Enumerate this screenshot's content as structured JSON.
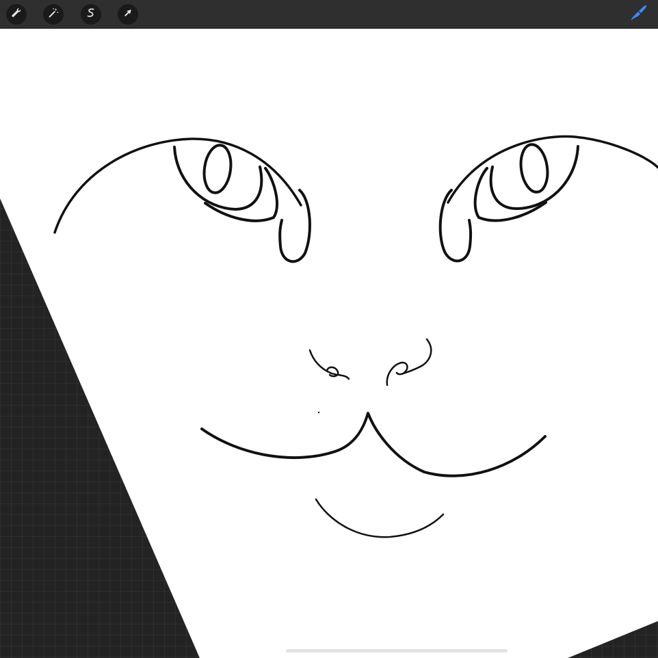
{
  "app": {
    "background_color": "#232323",
    "canvas_color": "#ffffff",
    "stroke_color": "#111111",
    "accent_color": "#3a8bff"
  },
  "toolbar": {
    "tools": [
      {
        "name": "actions",
        "icon": "wrench-icon",
        "label": ""
      },
      {
        "name": "adjustments",
        "icon": "magic-wand-icon",
        "label": ""
      },
      {
        "name": "selection",
        "icon": "selection-s-icon",
        "label": ""
      },
      {
        "name": "transform",
        "icon": "arrow-cursor-icon",
        "label": ""
      }
    ],
    "brush": {
      "icon": "brush-icon",
      "active_color": "#3a8bff"
    }
  }
}
